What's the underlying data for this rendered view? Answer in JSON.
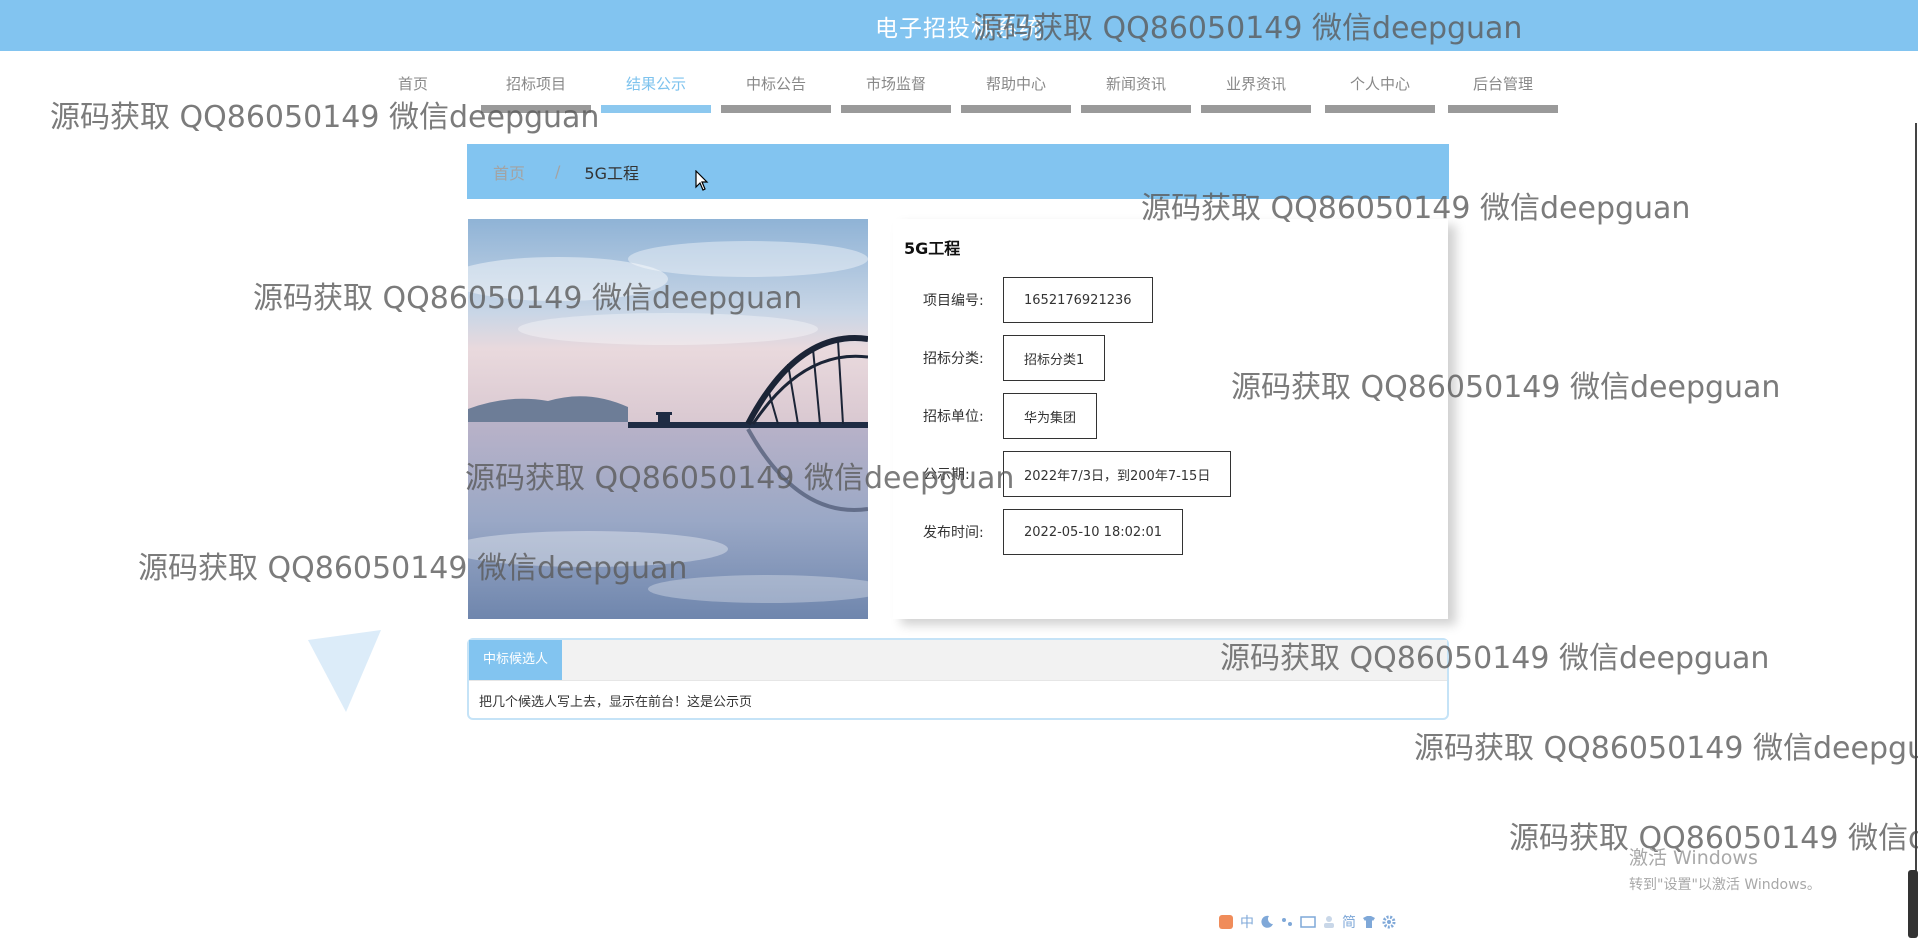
{
  "header": {
    "site_title": "电子招投标系统"
  },
  "nav": {
    "items": [
      {
        "label": "首页"
      },
      {
        "label": "招标项目"
      },
      {
        "label": "结果公示"
      },
      {
        "label": "中标公告"
      },
      {
        "label": "市场监督"
      },
      {
        "label": "帮助中心"
      },
      {
        "label": "新闻资讯"
      },
      {
        "label": "业界资讯"
      },
      {
        "label": "个人中心"
      },
      {
        "label": "后台管理"
      }
    ],
    "active": "结果公示"
  },
  "breadcrumb": {
    "home": "首页",
    "separator": "/",
    "current": "5G工程"
  },
  "project": {
    "title": "5G工程",
    "fields": [
      {
        "label": "项目编号:",
        "value": "1652176921236"
      },
      {
        "label": "招标分类:",
        "value": "招标分类1"
      },
      {
        "label": "招标单位:",
        "value": "华为集团"
      },
      {
        "label": "公示期:",
        "value": "2022年7/3日，到200年7-15日"
      },
      {
        "label": "发布时间:",
        "value": "2022-05-10 18:02:01"
      }
    ]
  },
  "candidates": {
    "tab_label": "中标候选人",
    "content": "把几个候选人写上去，显示在前台！这是公示页"
  },
  "watermark": {
    "text": "源码获取 QQ86050149 微信deepguan"
  },
  "os_overlay": {
    "activate_title": "激活 Windows",
    "activate_sub": "转到\"设置\"以激活 Windows。"
  },
  "ime": {
    "items": [
      "中",
      "简"
    ]
  },
  "colors": {
    "primary": "#82c4f0",
    "nav_underline": "#9a9a9a",
    "text": "#333333"
  }
}
